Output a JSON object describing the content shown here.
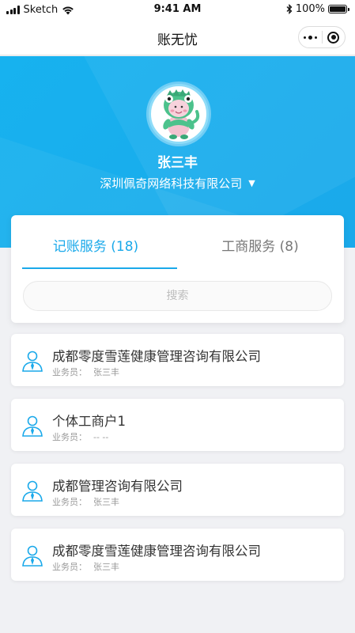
{
  "status_bar": {
    "carrier": "Sketch",
    "time": "9:41 AM",
    "battery": "100%",
    "battery_level": 1.0
  },
  "nav": {
    "title": "账无忧"
  },
  "profile": {
    "name": "张三丰",
    "company": "深圳佩奇网络科技有限公司",
    "avatar_icon": "mascot-avatar"
  },
  "tabs": [
    {
      "label": "记账服务 (18)",
      "active": true
    },
    {
      "label": "工商服务 (8)",
      "active": false
    }
  ],
  "search": {
    "placeholder": "搜索"
  },
  "colors": {
    "accent": "#1aa9ea",
    "hero": "#17b2ef"
  },
  "list": {
    "salesperson_label": "业务员：",
    "items": [
      {
        "title": "成都零度雪莲健康管理咨询有限公司",
        "salesperson": "张三丰"
      },
      {
        "title": "个体工商户1",
        "salesperson": "-- --"
      },
      {
        "title": "成都管理咨询有限公司",
        "salesperson": "张三丰"
      },
      {
        "title": "成都零度雪莲健康管理咨询有限公司",
        "salesperson": "张三丰"
      }
    ]
  }
}
